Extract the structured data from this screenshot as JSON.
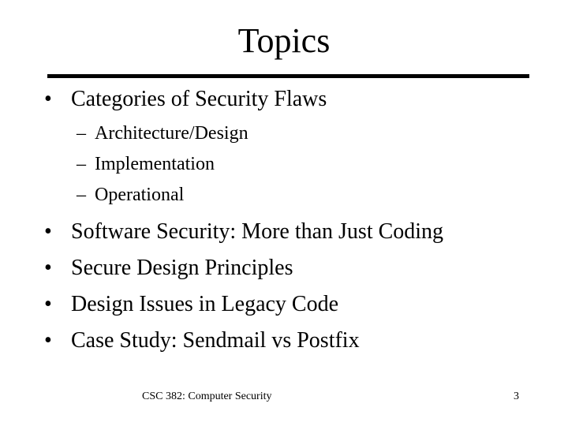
{
  "slide": {
    "title": "Topics",
    "bullets": [
      {
        "glyph": "•",
        "text": "Categories of Security Flaws",
        "subitems": [
          {
            "glyph": "–",
            "text": "Architecture/Design"
          },
          {
            "glyph": "–",
            "text": "Implementation"
          },
          {
            "glyph": "–",
            "text": "Operational"
          }
        ]
      },
      {
        "glyph": "•",
        "text": "Software Security: More than Just Coding"
      },
      {
        "glyph": "•",
        "text": "Secure Design Principles"
      },
      {
        "glyph": "•",
        "text": "Design Issues in Legacy Code"
      },
      {
        "glyph": "•",
        "text": "Case Study: Sendmail vs Postfix"
      }
    ],
    "footer": {
      "course": "CSC 382: Computer Security",
      "page_number": "3"
    }
  }
}
